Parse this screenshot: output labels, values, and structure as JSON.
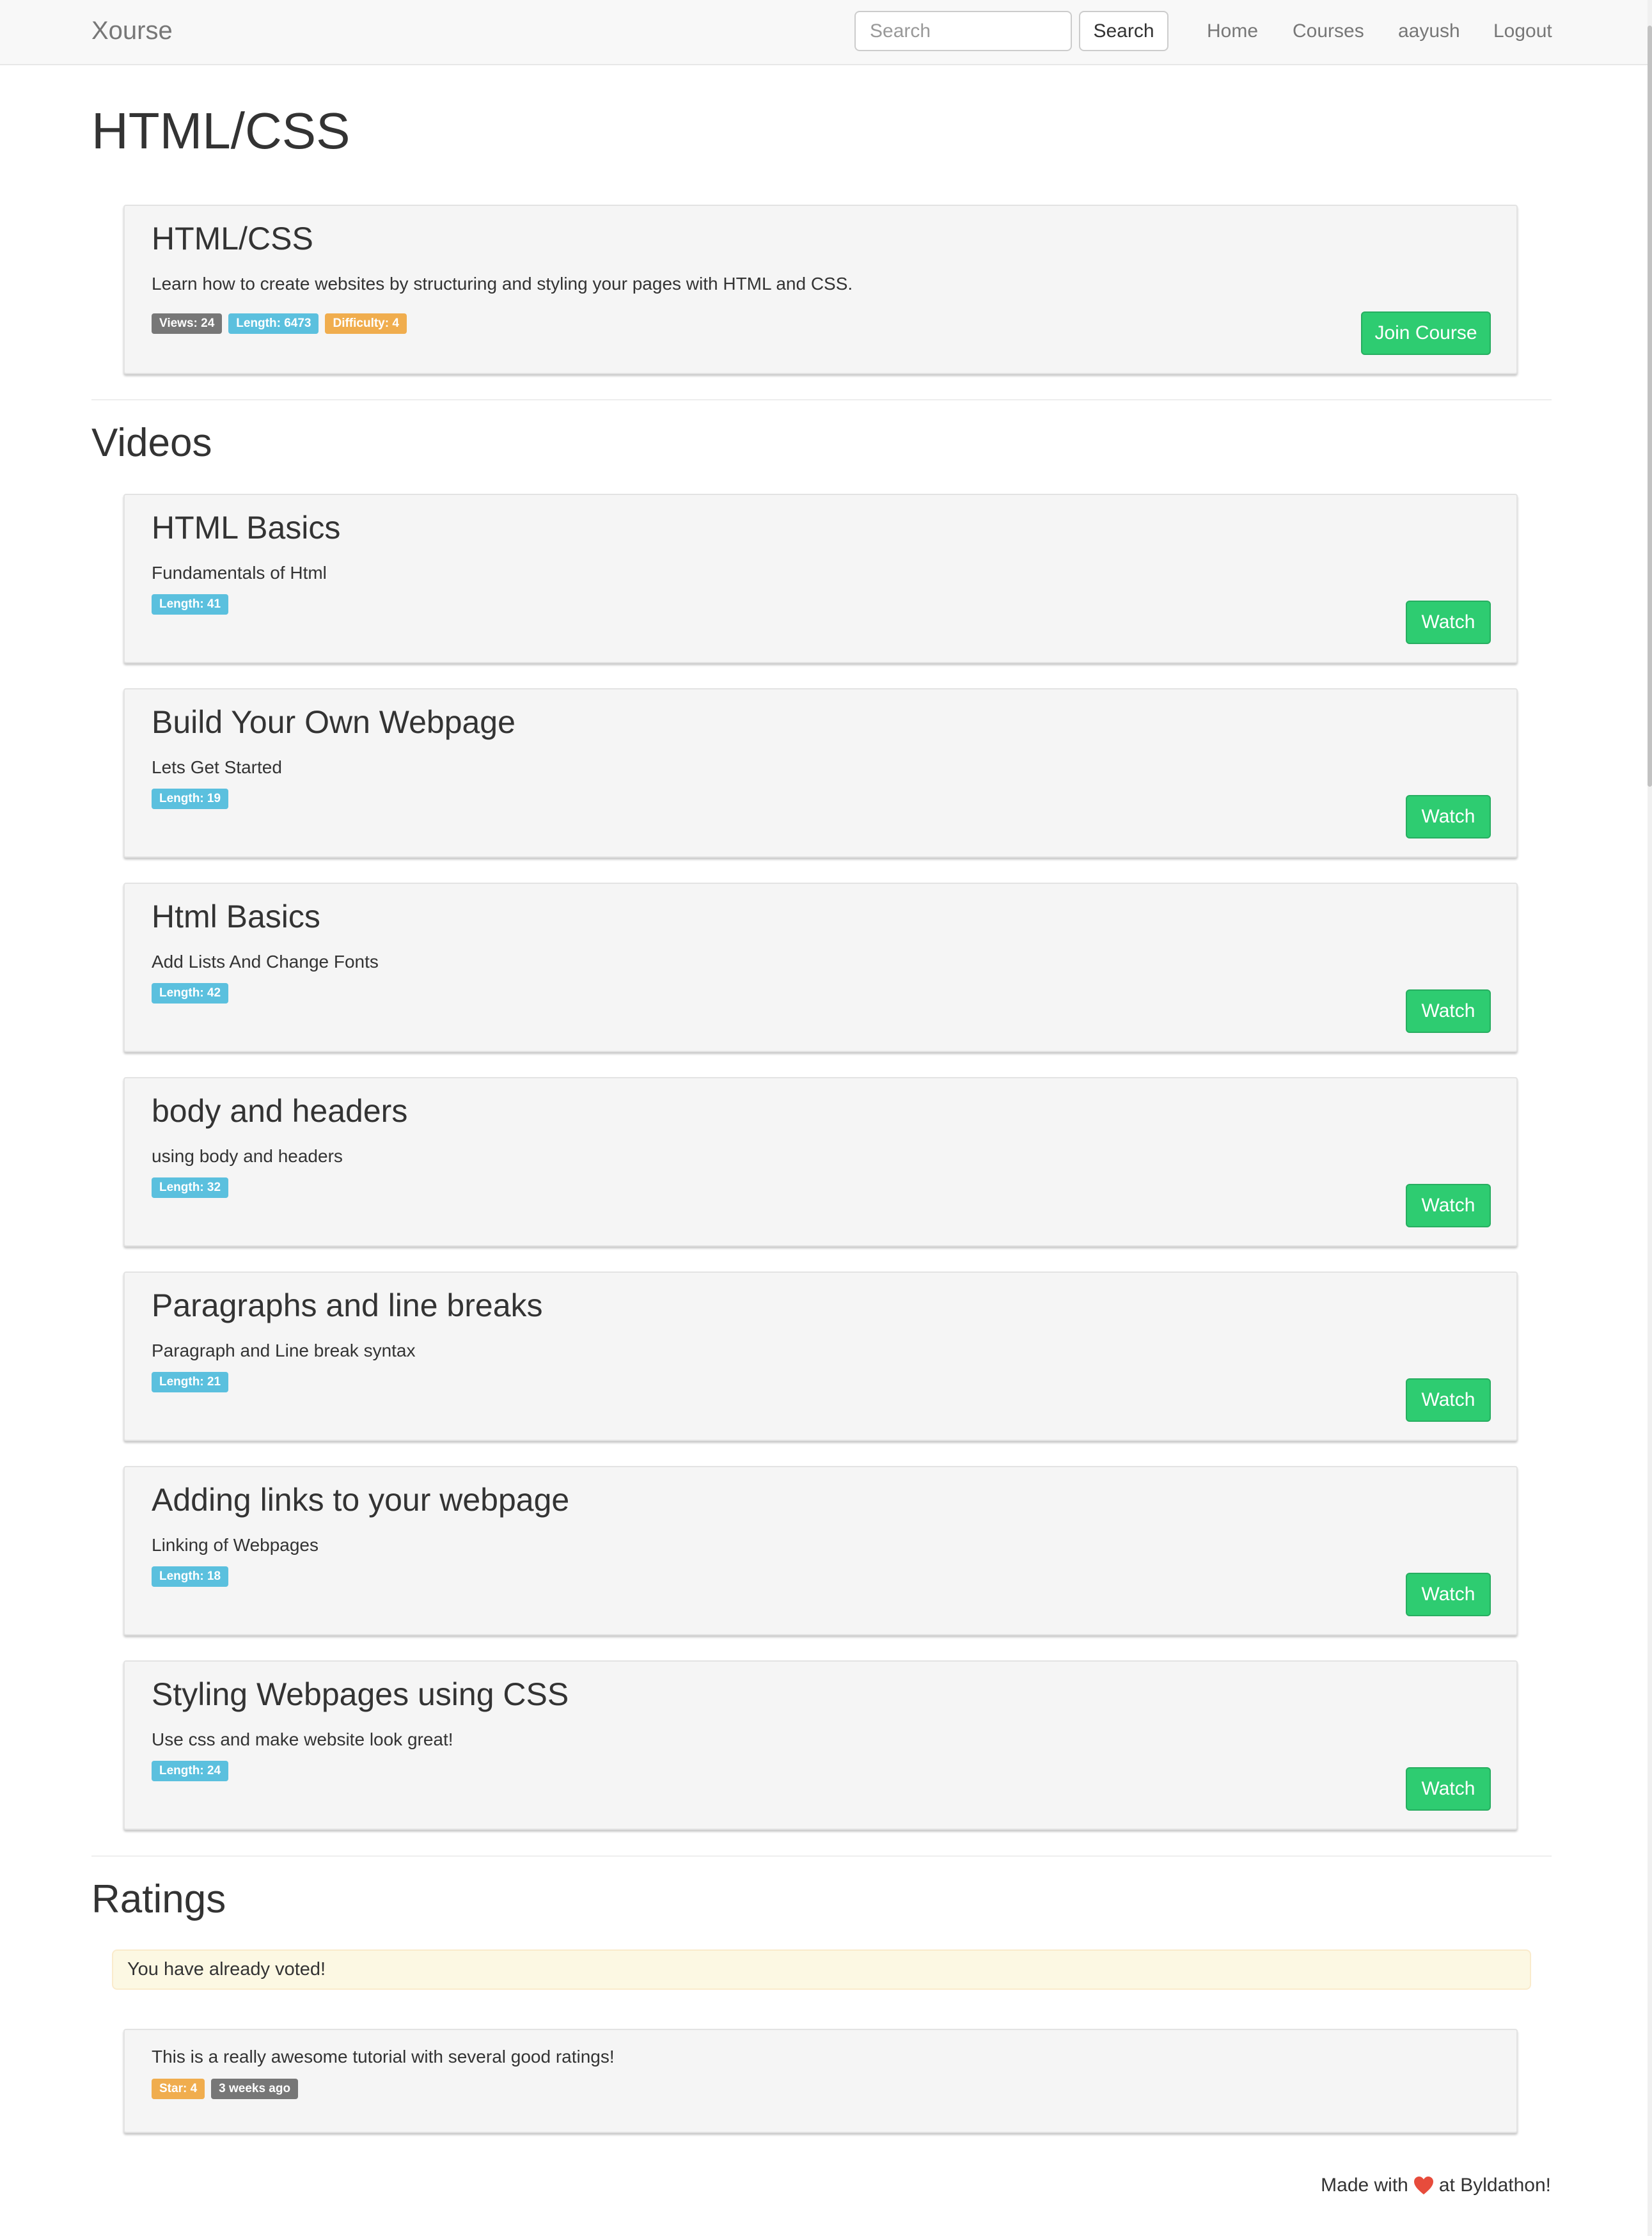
{
  "navbar": {
    "brand": "Xourse",
    "search_placeholder": "Search",
    "search_button": "Search",
    "links": [
      "Home",
      "Courses",
      "aayush",
      "Logout"
    ]
  },
  "page_title": "HTML/CSS",
  "course": {
    "title": "HTML/CSS",
    "description": "Learn how to create websites by structuring and styling your pages with HTML and CSS.",
    "badges": {
      "views": "Views: 24",
      "length": "Length: 6473",
      "difficulty": "Difficulty: 4"
    },
    "join_button": "Join Course"
  },
  "videos_heading": "Videos",
  "videos": [
    {
      "title": "HTML Basics",
      "description": "Fundamentals of Html",
      "length": "Length: 41",
      "button": "Watch"
    },
    {
      "title": "Build Your Own Webpage",
      "description": "Lets Get Started",
      "length": "Length: 19",
      "button": "Watch"
    },
    {
      "title": "Html Basics",
      "description": "Add Lists And Change Fonts",
      "length": "Length: 42",
      "button": "Watch"
    },
    {
      "title": "body and headers",
      "description": "using body and headers",
      "length": "Length: 32",
      "button": "Watch"
    },
    {
      "title": "Paragraphs and line breaks",
      "description": "Paragraph and Line break syntax",
      "length": "Length: 21",
      "button": "Watch"
    },
    {
      "title": "Adding links to your webpage",
      "description": "Linking of Webpages",
      "length": "Length: 18",
      "button": "Watch"
    },
    {
      "title": "Styling Webpages using CSS",
      "description": "Use css and make website look great!",
      "length": "Length: 24",
      "button": "Watch"
    }
  ],
  "ratings_heading": "Ratings",
  "alert": "You have already voted!",
  "rating": {
    "text": "This is a really awesome tutorial with several good ratings!",
    "star": "Star: 4",
    "time": "3 weeks ago"
  },
  "footer": {
    "prefix": "Made with",
    "suffix": "at Byldathon!"
  },
  "colors": {
    "badge_default": "#777777",
    "badge_info": "#5bc0de",
    "badge_warning": "#f0ad4e",
    "button_success": "#2ecc71",
    "heart": "#e74c3c"
  }
}
